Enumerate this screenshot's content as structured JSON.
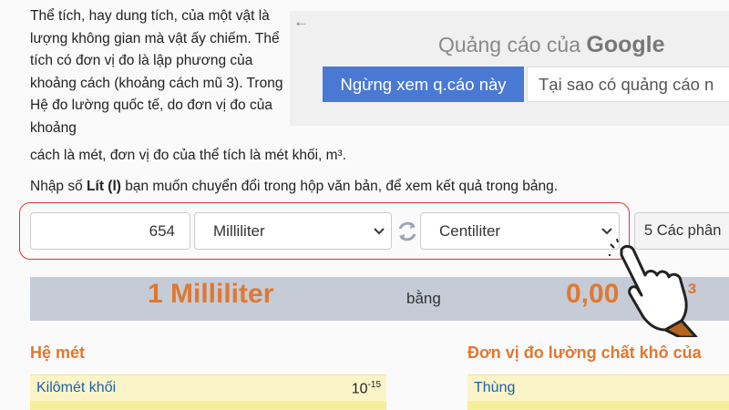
{
  "intro": {
    "paragraph": "Thể tích, hay dung tích, của một vật là lượng không gian mà vật ấy chiếm. Thể tích có đơn vị đo là lập phương của khoảng cách (khoảng cách mũ 3). Trong Hệ đo lường quốc tế, do đơn vị đo của khoảng",
    "tail": "cách là mét, đơn vị đo của thể tích là mét khối, m³."
  },
  "ad": {
    "back": "←",
    "title_prefix": "Quảng cáo của",
    "title_brand": "Google",
    "stop_button": "Ngừng xem q.cáo này",
    "why_button": "Tại sao có quảng cáo n"
  },
  "prompt": {
    "before": "Nhập số ",
    "bold": "Lít (l)",
    "after": " bạn muốn chuyển đổi trong hộp văn bản, để xem kết quả trong bảng."
  },
  "converter": {
    "value": "654",
    "from_unit": "Milliliter",
    "to_unit": "Centiliter",
    "decimals": "5 Các phân"
  },
  "result": {
    "left": "1 Milliliter",
    "middle": "bằng",
    "right": "0,00",
    "right_unit": "m³"
  },
  "sections": {
    "metric_title": "Hệ mét",
    "dry_title": "Đơn vị đo lường chất khô của"
  },
  "metric_rows": [
    {
      "label": "Kilômét khối",
      "value_base": "10",
      "value_exp": "-15"
    }
  ],
  "dry_rows": [
    {
      "label": "Thùng"
    }
  ],
  "colors": {
    "accent_orange": "#e07830",
    "link_blue": "#1f5fa8",
    "ad_button_blue": "#4a79d4",
    "highlight_red": "#e03535",
    "row_yellow": "#fbf4c8"
  },
  "icons": {
    "swap": "swap-icon",
    "chevron": "chevron-down-icon",
    "hand": "pointing-hand-icon",
    "back": "back-arrow-icon"
  }
}
